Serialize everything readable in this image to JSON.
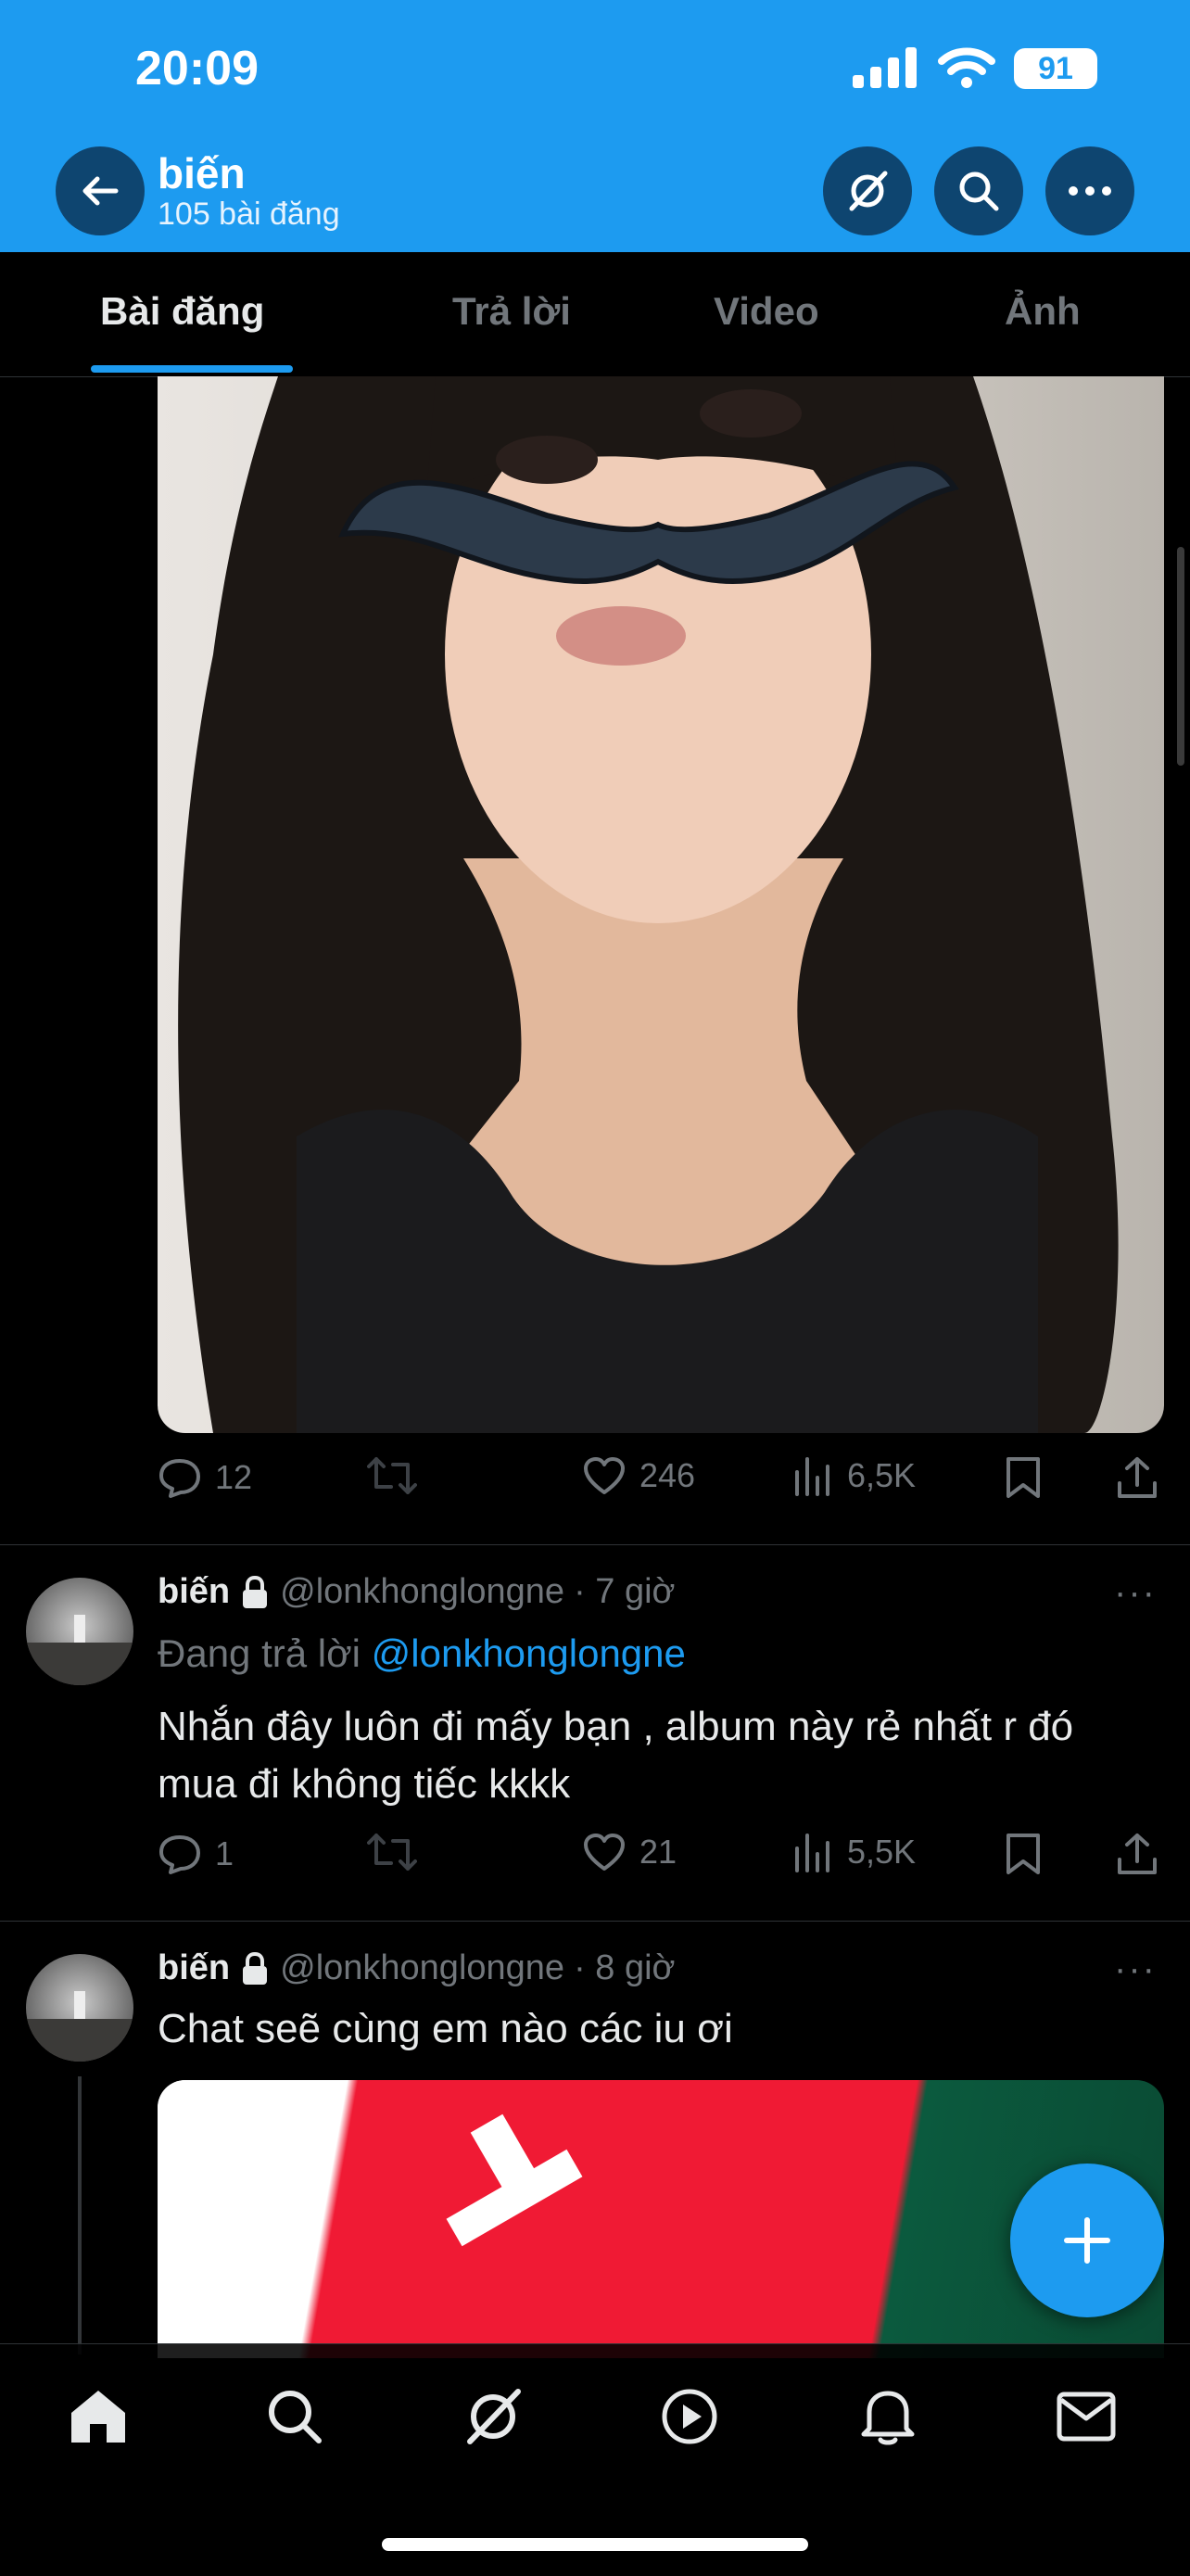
{
  "status_bar": {
    "time": "20:09",
    "battery": "91"
  },
  "header": {
    "name": "biến",
    "post_count": "105 bài đăng"
  },
  "tabs": [
    {
      "label": "Bài đăng",
      "active": true
    },
    {
      "label": "Trả lời",
      "active": false
    },
    {
      "label": "Video",
      "active": false
    },
    {
      "label": "Ảnh",
      "active": false
    }
  ],
  "post1": {
    "media": "selfie-photo-with-mustache-sticker",
    "actions": {
      "replies": "12",
      "likes": "246",
      "views": "6,5K"
    }
  },
  "post2": {
    "name": "biến",
    "handle": "@lonkhonglongne",
    "time": "· 7 giờ",
    "reply_prefix": "Đang trả lời",
    "reply_to": "@lonkhonglongne",
    "text": "Nhắn đây luôn đi mấy bạn , album này rẻ nhất r đó mua đi không tiếc kkkk",
    "actions": {
      "replies": "1",
      "likes": "21",
      "views": "5,5K"
    }
  },
  "post3": {
    "name": "biến",
    "handle": "@lonkhonglongne",
    "time": "· 8 giờ",
    "text": "Chat seẽ cùng em nào các iu ơi"
  },
  "colors": {
    "accent": "#1d9bf0",
    "background": "#000000",
    "muted": "#71767b"
  },
  "bottom_nav": [
    "home-icon",
    "search-icon",
    "grok-icon",
    "video-icon",
    "notifications-icon",
    "messages-icon"
  ]
}
